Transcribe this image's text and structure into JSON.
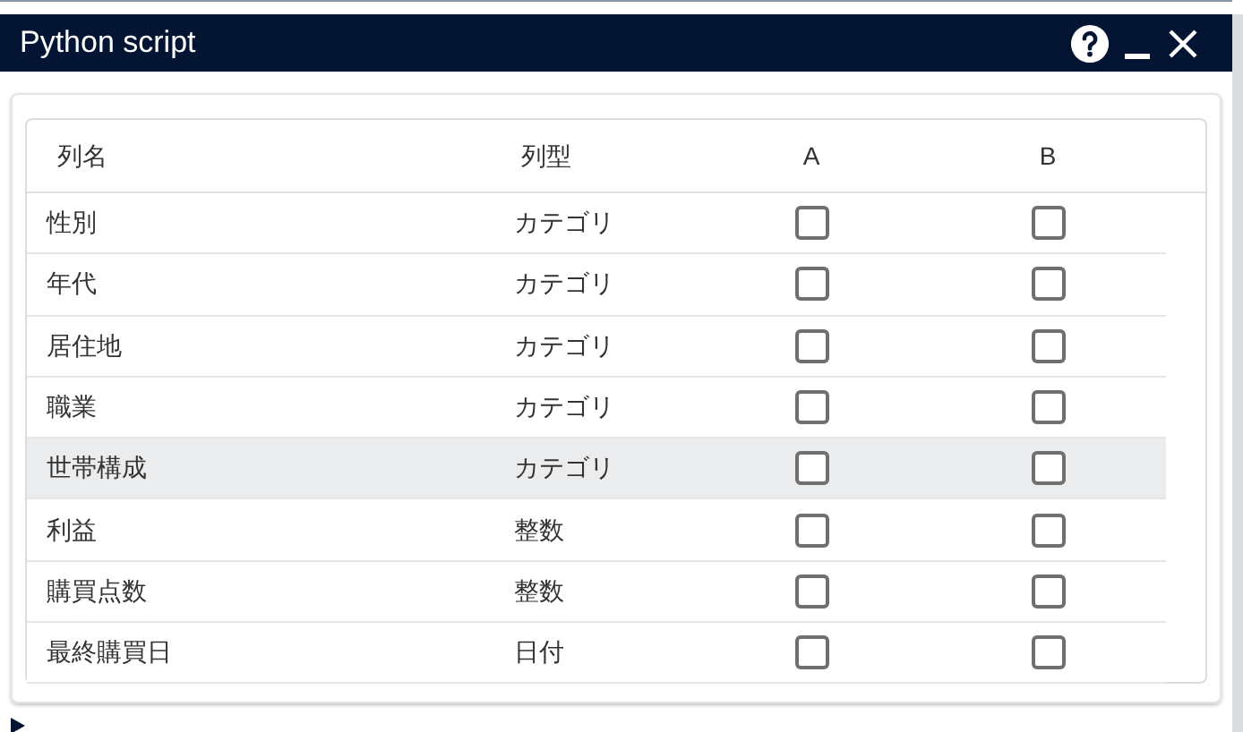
{
  "window": {
    "title": "Python script"
  },
  "table": {
    "columns": [
      "列名",
      "列型",
      "A",
      "B"
    ],
    "rows": [
      {
        "name": "性別",
        "type": "カテゴリ",
        "a_checked": false,
        "b_checked": false,
        "selected": false
      },
      {
        "name": "年代",
        "type": "カテゴリ",
        "a_checked": false,
        "b_checked": false,
        "selected": false
      },
      {
        "name": "居住地",
        "type": "カテゴリ",
        "a_checked": false,
        "b_checked": false,
        "selected": false
      },
      {
        "name": "職業",
        "type": "カテゴリ",
        "a_checked": false,
        "b_checked": false,
        "selected": false
      },
      {
        "name": "世帯構成",
        "type": "カテゴリ",
        "a_checked": false,
        "b_checked": false,
        "selected": true
      },
      {
        "name": "利益",
        "type": "整数",
        "a_checked": false,
        "b_checked": false,
        "selected": false
      },
      {
        "name": "購買点数",
        "type": "整数",
        "a_checked": false,
        "b_checked": false,
        "selected": false
      },
      {
        "name": "最終購買日",
        "type": "日付",
        "a_checked": false,
        "b_checked": false,
        "selected": false
      }
    ]
  }
}
